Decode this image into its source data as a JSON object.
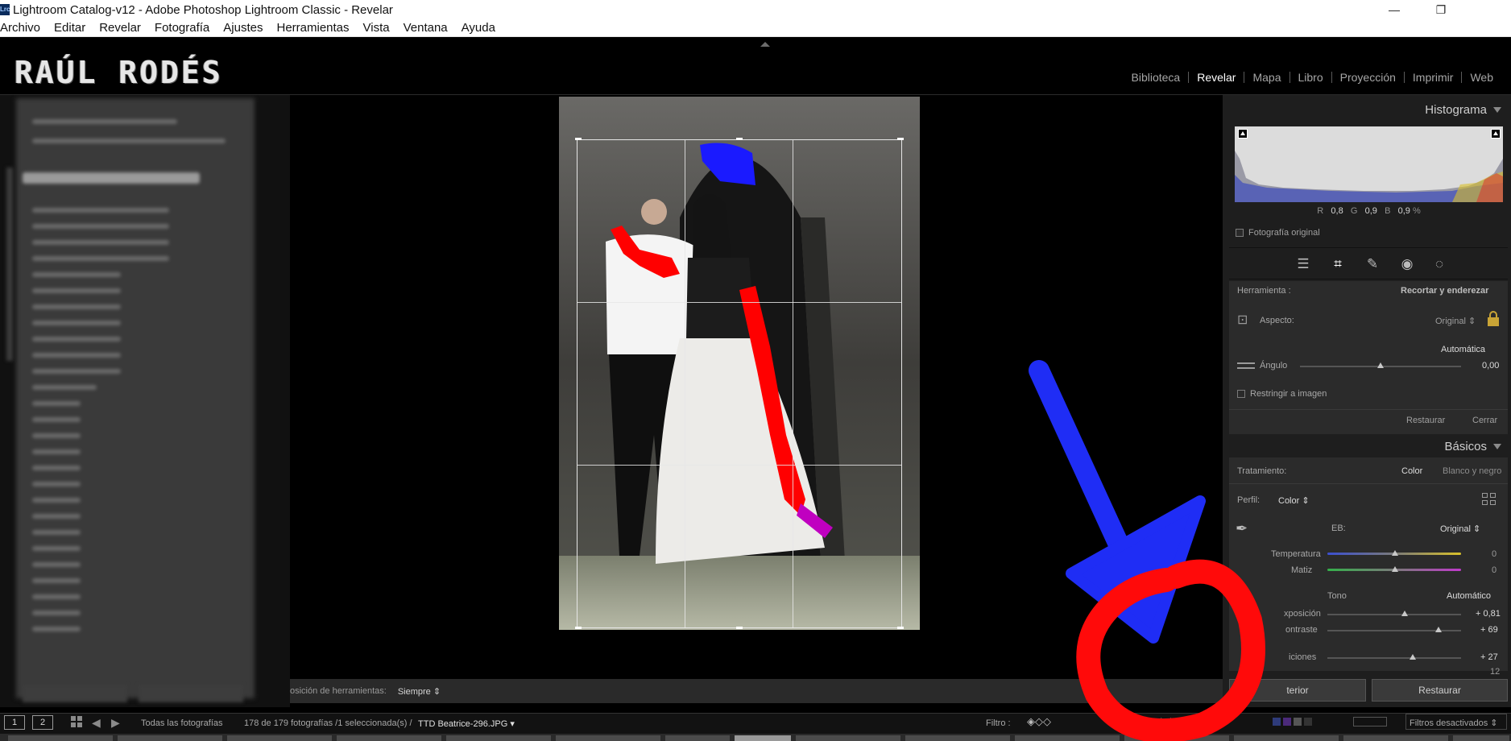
{
  "titlebar": {
    "app_icon": "Lrc",
    "title": "Lightroom Catalog-v12 - Adobe Photoshop Lightroom Classic - Revelar",
    "minimize": "—",
    "restore": "❐"
  },
  "menu": [
    "Archivo",
    "Editar",
    "Revelar",
    "Fotografía",
    "Ajustes",
    "Herramientas",
    "Vista",
    "Ventana",
    "Ayuda"
  ],
  "identity_plate": "RAÚL RODÉS",
  "modules": [
    "Biblioteca",
    "Revelar",
    "Mapa",
    "Libro",
    "Proyección",
    "Imprimir",
    "Web"
  ],
  "active_module": "Revelar",
  "toolbar": {
    "label": "osición de herramientas:",
    "value": "Siempre ⇕"
  },
  "histogram": {
    "title": "Histograma",
    "r_label": "R",
    "r_value": "0,8",
    "g_label": "G",
    "g_value": "0,9",
    "b_label": "B",
    "b_value": "0,9",
    "unit": "%",
    "original_photo": "Fotografía original"
  },
  "crop": {
    "tool_label": "Herramienta :",
    "tool_name": "Recortar y enderezar",
    "aspect_label": "Aspecto:",
    "aspect_value": "Original ⇕",
    "auto": "Automática",
    "angle_label": "Ángulo",
    "angle_value": "0,00",
    "constrain": "Restringir a imagen",
    "reset": "Restaurar",
    "close": "Cerrar"
  },
  "basic": {
    "title": "Básicos",
    "treatment_label": "Tratamiento:",
    "treatment_color": "Color",
    "treatment_bw": "Blanco y negro",
    "profile_label": "Perfil:",
    "profile_value": "Color ⇕",
    "wb_label": "EB:",
    "wb_value": "Original ⇕",
    "temp_label": "Temperatura",
    "temp_value": "0",
    "tint_label": "Matiz",
    "tint_value": "0",
    "tone_label": "Tono",
    "tone_auto": "Automático",
    "exposure_label": "xposición",
    "exposure_value": "+ 0,81",
    "contrast_label": "ontraste",
    "contrast_value": "+ 69",
    "highlights_label": "iciones",
    "highlights_value": "+ 27",
    "shadows_value": "12"
  },
  "bottom_buttons": {
    "previous": "terior",
    "reset": "Restaurar"
  },
  "filmstrip": {
    "monitor1": "1",
    "monitor2": "2",
    "source": "Todas las fotografías",
    "count": "178 de 179 fotografías /1 seleccionada(s) /",
    "filename": "TTD Beatrice-296.JPG ▾",
    "filter_label": "Filtro :",
    "filters_off": "Filtros desactivados ⇕"
  },
  "icons": {
    "basic_panel": "sliders-icon",
    "crop": "crop-icon",
    "healing": "bandage-icon",
    "redeye": "eye-icon",
    "masking": "circle-mask-icon",
    "lock": "lock-icon",
    "eyedropper": "eyedropper-icon"
  },
  "colors": {
    "accent_annotation_blue": "#1f2df5",
    "accent_annotation_red": "#ff0a0a",
    "panel_bg": "#2b2b2b",
    "app_bg": "#000000"
  }
}
